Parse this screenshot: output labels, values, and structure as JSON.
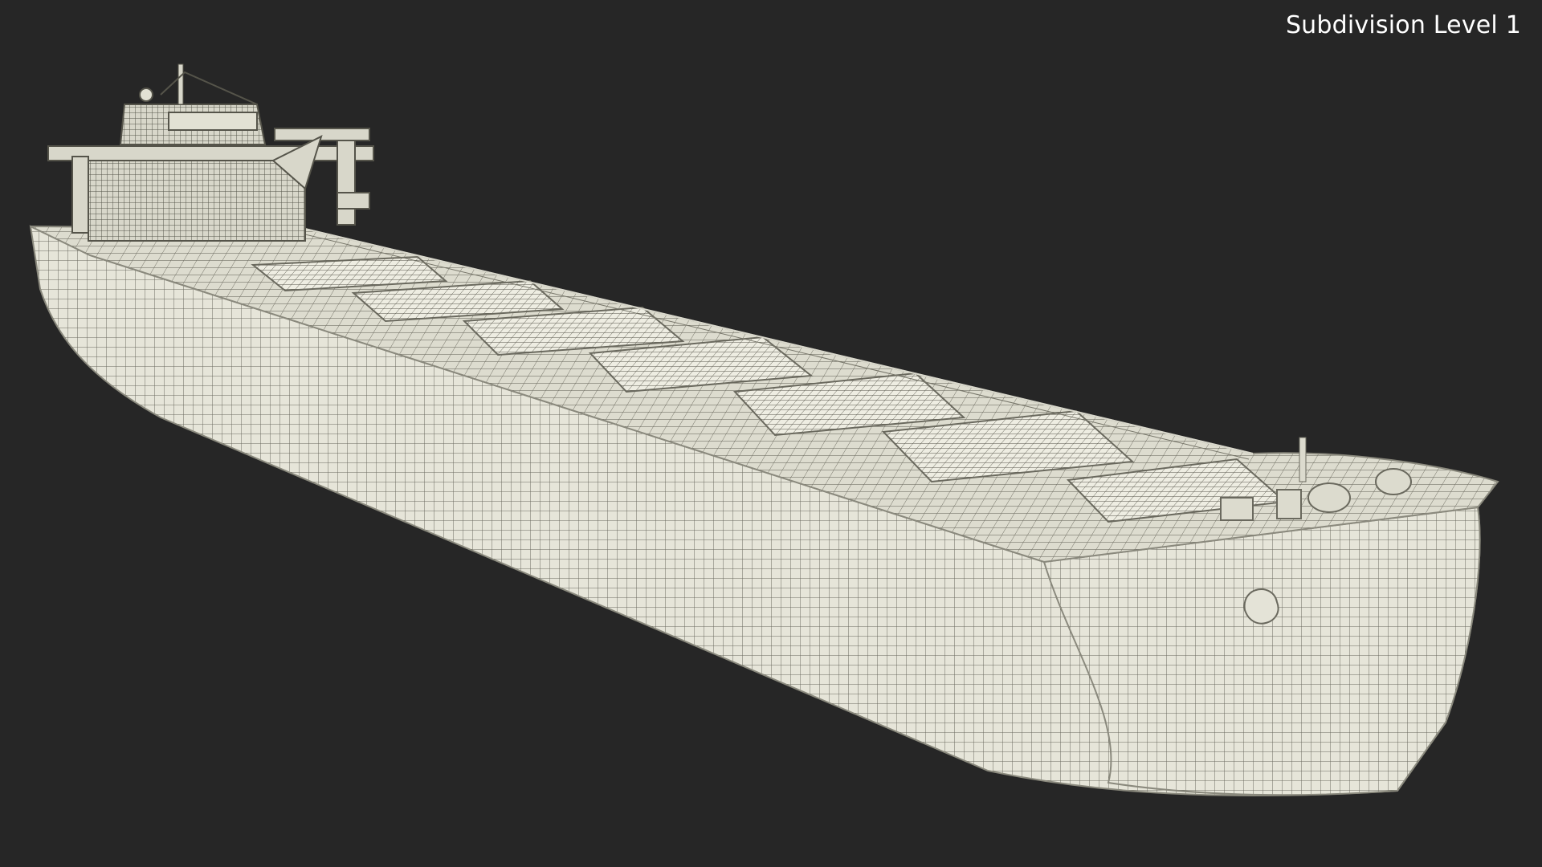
{
  "viewport": {
    "overlay_label": "Subdivision Level 1",
    "colors": {
      "background": "#262626",
      "wire": "#5b5a4f",
      "surface": "#e9e8dc"
    }
  },
  "model": {
    "icon": "bulk-carrier-ship-wireframe"
  }
}
